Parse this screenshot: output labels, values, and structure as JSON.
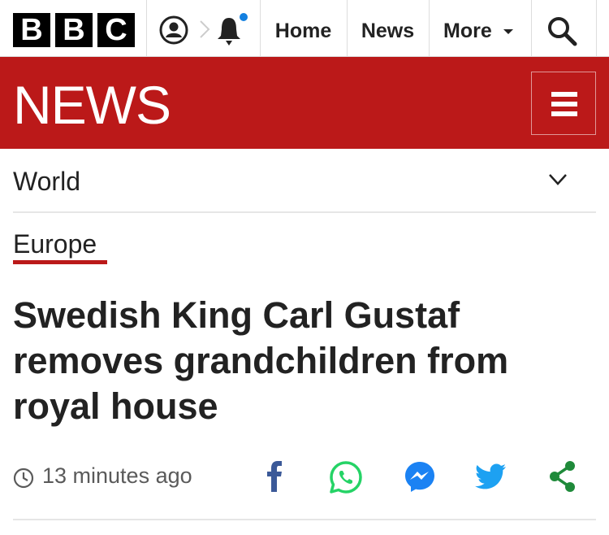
{
  "brand": {
    "logo_letters": [
      "B",
      "B",
      "C"
    ],
    "wordmark": "NEWS",
    "accent": "#bb1919"
  },
  "nav": {
    "items": [
      {
        "label": "Home"
      },
      {
        "label": "News"
      },
      {
        "label": "More"
      }
    ],
    "account_icon": "account-icon",
    "notification_icon": "bell-icon",
    "notification_dot_color": "#1380e0",
    "search_icon": "search-icon",
    "menu_icon": "hamburger-icon"
  },
  "section": {
    "label": "World"
  },
  "subsection": {
    "label": "Europe"
  },
  "article": {
    "headline": "Swedish King Carl Gustaf removes grandchildren from royal house",
    "timestamp": "13 minutes ago"
  },
  "share": [
    {
      "name": "facebook",
      "color": "#3b5998"
    },
    {
      "name": "whatsapp",
      "color": "#25d366"
    },
    {
      "name": "messenger",
      "color": "#1b82f3"
    },
    {
      "name": "twitter",
      "color": "#1da1f2"
    },
    {
      "name": "share",
      "color": "#1f8a3a"
    }
  ]
}
